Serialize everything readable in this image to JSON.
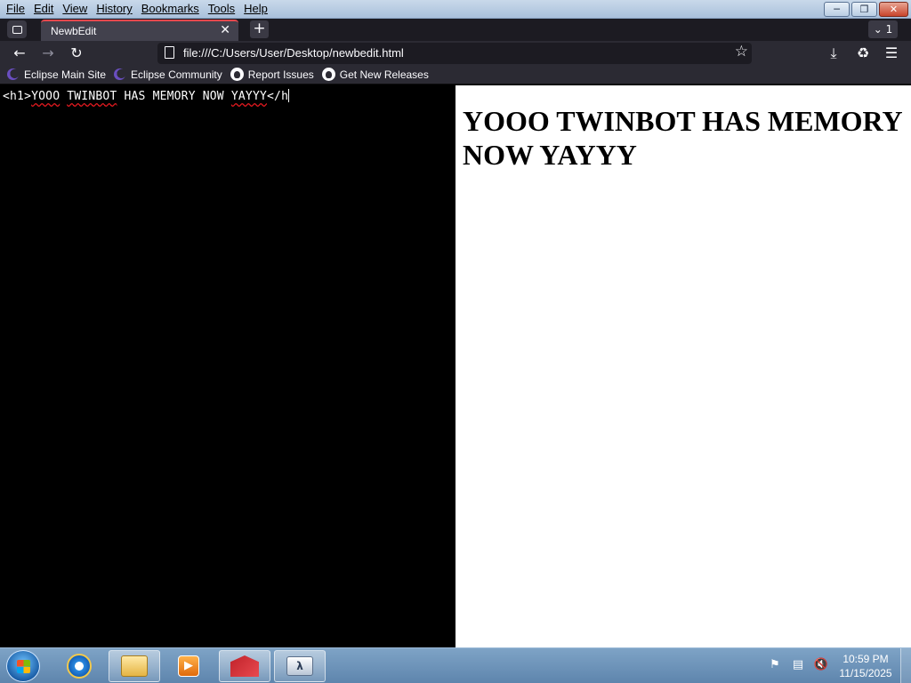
{
  "menu": {
    "items": [
      "File",
      "Edit",
      "View",
      "History",
      "Bookmarks",
      "Tools",
      "Help"
    ]
  },
  "window_controls": {
    "minimize_icon": "minimize-icon",
    "restore_icon": "restore-icon",
    "close_icon": "close-icon"
  },
  "tabs": {
    "active_title": "NewbEdit",
    "tab_count": "1"
  },
  "navbar": {
    "url": "file:///C:/Users/User/Desktop/newbedit.html"
  },
  "bookmarks": [
    {
      "label": "Eclipse Main Site",
      "icon": "eclipse-icon"
    },
    {
      "label": "Eclipse Community",
      "icon": "eclipse-icon"
    },
    {
      "label": "Report Issues",
      "icon": "github-icon"
    },
    {
      "label": "Get New Releases",
      "icon": "github-icon"
    }
  ],
  "editor": {
    "code_prefix": "<h1>",
    "word1": "YOOO",
    "word2": "TWINBOT",
    "middle": " HAS MEMORY NOW ",
    "word3": "YAYYY",
    "code_suffix": "</h"
  },
  "preview": {
    "heading": "YOOO TWINBOT HAS MEMORY NOW YAYYY"
  },
  "taskbar": {
    "clock_time": "10:59 PM",
    "clock_date": "11/15/2025"
  },
  "colors": {
    "accent_tab": "#e5484d",
    "toolbar": "#2b2a33",
    "editor_bg": "#000000",
    "preview_bg": "#ffffff"
  }
}
